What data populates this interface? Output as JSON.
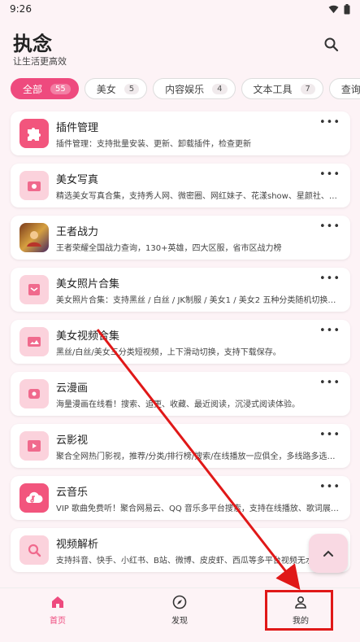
{
  "status_bar": {
    "time": "9:26"
  },
  "header": {
    "title": "执念",
    "subtitle": "让生活更高效"
  },
  "categories": [
    {
      "label": "全部",
      "count": "55",
      "active": true
    },
    {
      "label": "美女",
      "count": "5"
    },
    {
      "label": "内容娱乐",
      "count": "4"
    },
    {
      "label": "文本工具",
      "count": "7"
    },
    {
      "label": "查询工",
      "count": ""
    }
  ],
  "items": [
    {
      "title": "插件管理",
      "desc": "插件管理：支持批量安装、更新、卸载插件，检查更新",
      "icon": "puzzle-icon"
    },
    {
      "title": "美女写真",
      "desc": "精选美女写真合集，支持秀人网、微密圈、网红妹子、花漾show、星颜社、尤…",
      "icon": "camera-icon"
    },
    {
      "title": "王者战力",
      "desc": "王者荣耀全国战力查询，130+英雄，四大区服，省市区战力榜",
      "icon": "game-avatar-icon"
    },
    {
      "title": "美女照片合集",
      "desc": "美女照片合集：支持黑丝 / 白丝 / JK制服 / 美女1 / 美女2 五种分类随机切换，…",
      "icon": "photo-album-icon"
    },
    {
      "title": "美女视频合集",
      "desc": "黑丝/白丝/美女三分类短视频，上下滑动切换，支持下载保存。",
      "icon": "video-icon"
    },
    {
      "title": "云漫画",
      "desc": "海量漫画在线看！搜索、追更、收藏、最近阅读，沉浸式阅读体验。",
      "icon": "comic-icon"
    },
    {
      "title": "云影视",
      "desc": "聚合全网热门影视，推荐/分类/排行榜/搜索/在线播放一应俱全，多线路多选集…",
      "icon": "play-icon"
    },
    {
      "title": "云音乐",
      "desc": "VIP 歌曲免费听！聚合网易云、QQ 音乐多平台搜索，支持在线播放、歌词展示…",
      "icon": "music-cloud-icon"
    },
    {
      "title": "视频解析",
      "desc": "支持抖音、快手、小红书、B站、微博、皮皮虾、西瓜等多平台视频无水…",
      "icon": "video-search-icon"
    }
  ],
  "more_label": "•••",
  "bottom_nav": [
    {
      "label": "首页",
      "icon": "home-icon",
      "active": true
    },
    {
      "label": "发现",
      "icon": "compass-icon"
    },
    {
      "label": "我的",
      "icon": "person-icon"
    }
  ],
  "colors": {
    "accent": "#ee4a7e",
    "background": "#fdf3f6",
    "annotation": "#e01818"
  }
}
